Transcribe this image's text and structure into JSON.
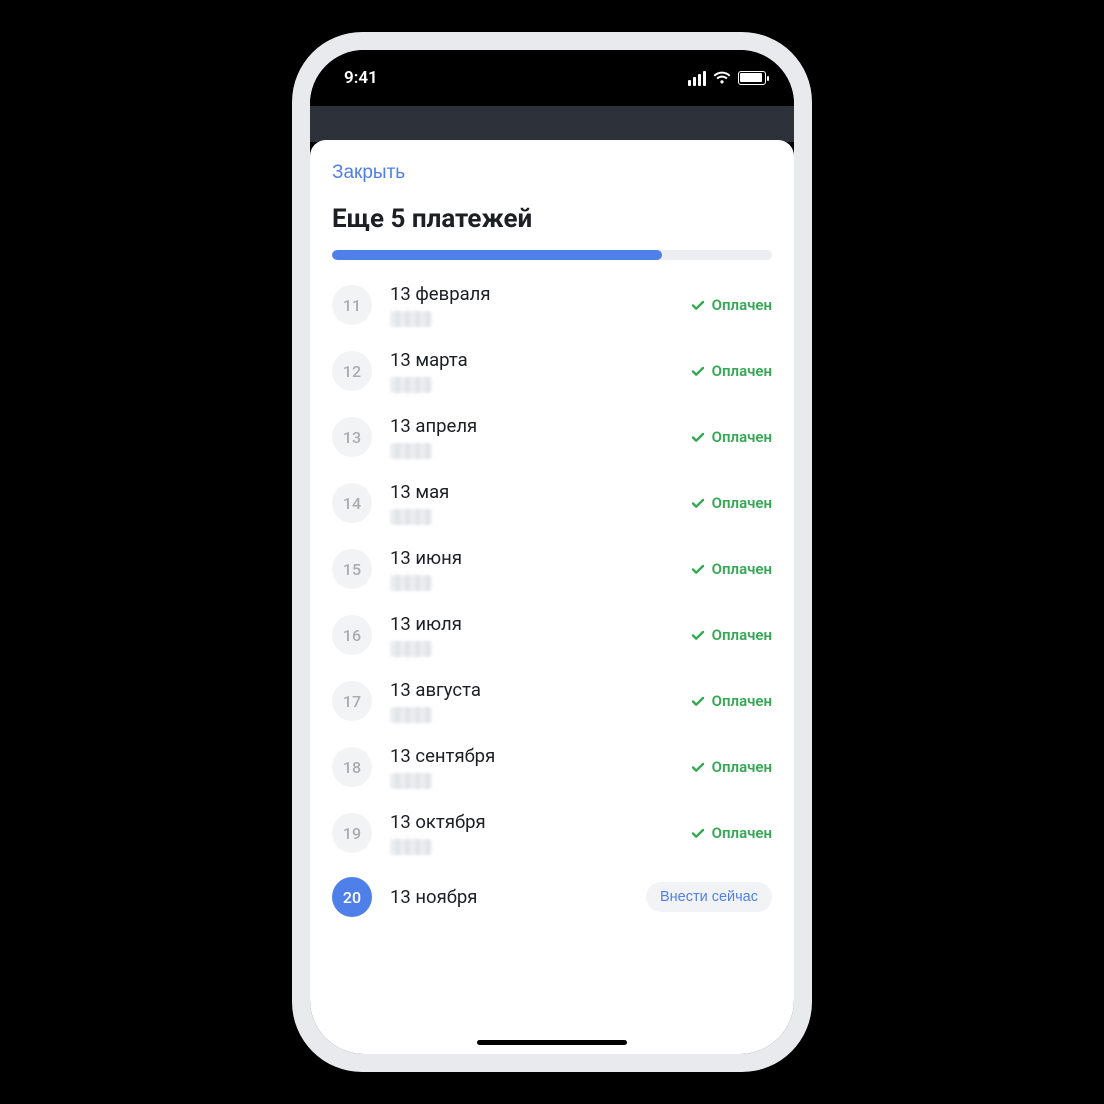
{
  "statusBar": {
    "time": "9:41"
  },
  "sheet": {
    "closeLabel": "Закрыть",
    "title": "Еще 5 платежей",
    "progressPercent": 75,
    "paidLabel": "Оплачен",
    "payNowLabel": "Внести сейчас",
    "colors": {
      "accent": "#4f7fe8",
      "success": "#34a853"
    }
  },
  "payments": [
    {
      "num": "11",
      "date": "13 февраля",
      "status": "paid"
    },
    {
      "num": "12",
      "date": "13 марта",
      "status": "paid"
    },
    {
      "num": "13",
      "date": "13 апреля",
      "status": "paid"
    },
    {
      "num": "14",
      "date": "13 мая",
      "status": "paid"
    },
    {
      "num": "15",
      "date": "13 июня",
      "status": "paid"
    },
    {
      "num": "16",
      "date": "13 июля",
      "status": "paid"
    },
    {
      "num": "17",
      "date": "13 августа",
      "status": "paid"
    },
    {
      "num": "18",
      "date": "13 сентября",
      "status": "paid"
    },
    {
      "num": "19",
      "date": "13 октября",
      "status": "paid"
    },
    {
      "num": "20",
      "date": "13 ноября",
      "status": "due",
      "active": true
    }
  ]
}
